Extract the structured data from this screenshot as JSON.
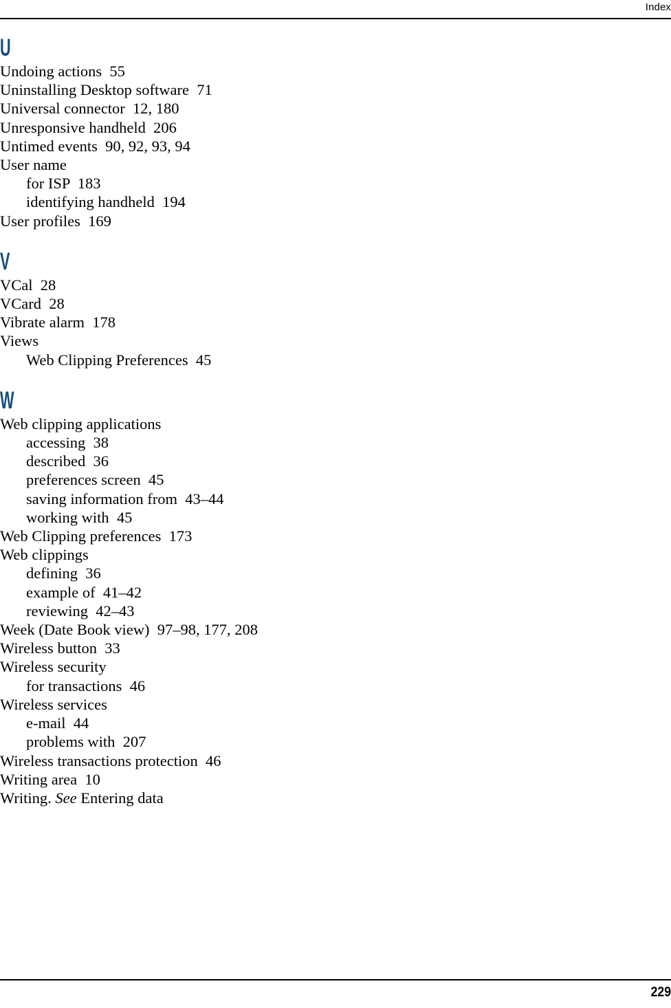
{
  "header": {
    "running_head": "Index"
  },
  "footer": {
    "page_number": "229"
  },
  "colors": {
    "letter_heading": "#164C7E",
    "body_text": "#000000",
    "rule": "#000000",
    "background": "#FFFFFF"
  },
  "sections": [
    {
      "letter": "U",
      "entries": [
        {
          "level": 1,
          "text": "Undoing actions  55"
        },
        {
          "level": 1,
          "text": "Uninstalling Desktop software  71"
        },
        {
          "level": 1,
          "text": "Universal connector  12, 180"
        },
        {
          "level": 1,
          "text": "Unresponsive handheld  206"
        },
        {
          "level": 1,
          "text": "Untimed events  90, 92, 93, 94"
        },
        {
          "level": 1,
          "text": "User name"
        },
        {
          "level": 2,
          "text": "for ISP  183"
        },
        {
          "level": 2,
          "text": "identifying handheld  194"
        },
        {
          "level": 1,
          "text": "User profiles  169"
        }
      ]
    },
    {
      "letter": "V",
      "entries": [
        {
          "level": 1,
          "text": "VCal  28"
        },
        {
          "level": 1,
          "text": "VCard  28"
        },
        {
          "level": 1,
          "text": "Vibrate alarm  178"
        },
        {
          "level": 1,
          "text": "Views"
        },
        {
          "level": 2,
          "text": "Web Clipping Preferences  45"
        }
      ]
    },
    {
      "letter": "W",
      "entries": [
        {
          "level": 1,
          "text": "Web clipping applications"
        },
        {
          "level": 2,
          "text": "accessing  38"
        },
        {
          "level": 2,
          "text": "described  36"
        },
        {
          "level": 2,
          "text": "preferences screen  45"
        },
        {
          "level": 2,
          "text": "saving information from  43–44"
        },
        {
          "level": 2,
          "text": "working with  45"
        },
        {
          "level": 1,
          "text": "Web Clipping preferences  173"
        },
        {
          "level": 1,
          "text": "Web clippings"
        },
        {
          "level": 2,
          "text": "defining  36"
        },
        {
          "level": 2,
          "text": "example of  41–42"
        },
        {
          "level": 2,
          "text": "reviewing  42–43"
        },
        {
          "level": 1,
          "text": "Week (Date Book view)  97–98, 177, 208"
        },
        {
          "level": 1,
          "text": "Wireless button  33"
        },
        {
          "level": 1,
          "text": "Wireless security"
        },
        {
          "level": 2,
          "text": "for transactions  46"
        },
        {
          "level": 1,
          "text": "Wireless services"
        },
        {
          "level": 2,
          "text": "e-mail  44"
        },
        {
          "level": 2,
          "text": "problems with  207"
        },
        {
          "level": 1,
          "text": "Wireless transactions protection  46"
        },
        {
          "level": 1,
          "text": "Writing area  10"
        },
        {
          "level": 1,
          "text": "Writing. ",
          "italic_part": "See",
          "text_after": " Entering data"
        }
      ]
    }
  ]
}
